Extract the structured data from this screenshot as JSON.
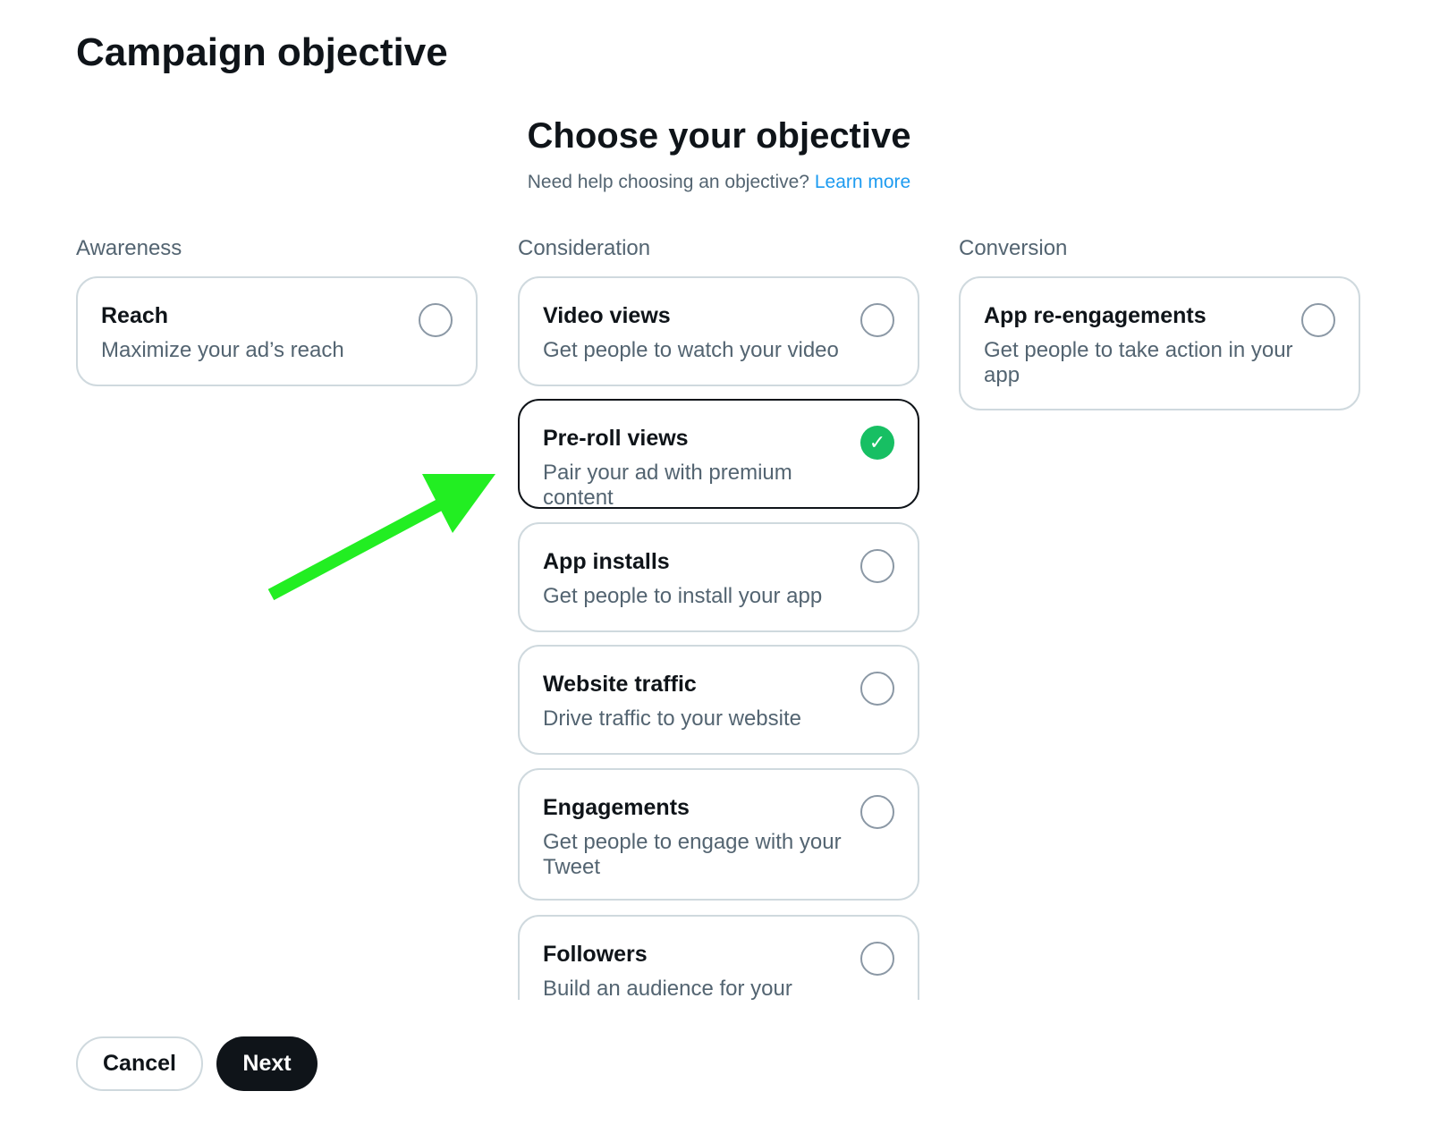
{
  "page_title": "Campaign objective",
  "heading": "Choose your objective",
  "help": {
    "text": "Need help choosing an objective?",
    "link": "Learn more"
  },
  "categories": {
    "awareness": "Awareness",
    "consideration": "Consideration",
    "conversion": "Conversion"
  },
  "objectives": [
    {
      "title": "Reach",
      "description": "Maximize your ad’s reach",
      "selected": false
    },
    {
      "title": "Video views",
      "description": "Get people to watch your video",
      "selected": false
    },
    {
      "title": "Pre-roll views",
      "description": "Pair your ad with premium content",
      "selected": true
    },
    {
      "title": "App installs",
      "description": "Get people to install your app",
      "selected": false
    },
    {
      "title": "Website traffic",
      "description": "Drive traffic to your website",
      "selected": false
    },
    {
      "title": "Engagements",
      "description": "Get people to engage with your Tweet",
      "selected": false
    },
    {
      "title": "Followers",
      "description": "Build an audience for your",
      "selected": false
    },
    {
      "title": "App re-engagements",
      "description": "Get people to take action in your app",
      "selected": false
    }
  ],
  "check_glyph": "✓",
  "colors": {
    "accent": "#1d9bf0",
    "selected_check": "#17bf63",
    "annotation_arrow": "#22ee22"
  },
  "buttons": {
    "cancel": "Cancel",
    "next": "Next"
  }
}
